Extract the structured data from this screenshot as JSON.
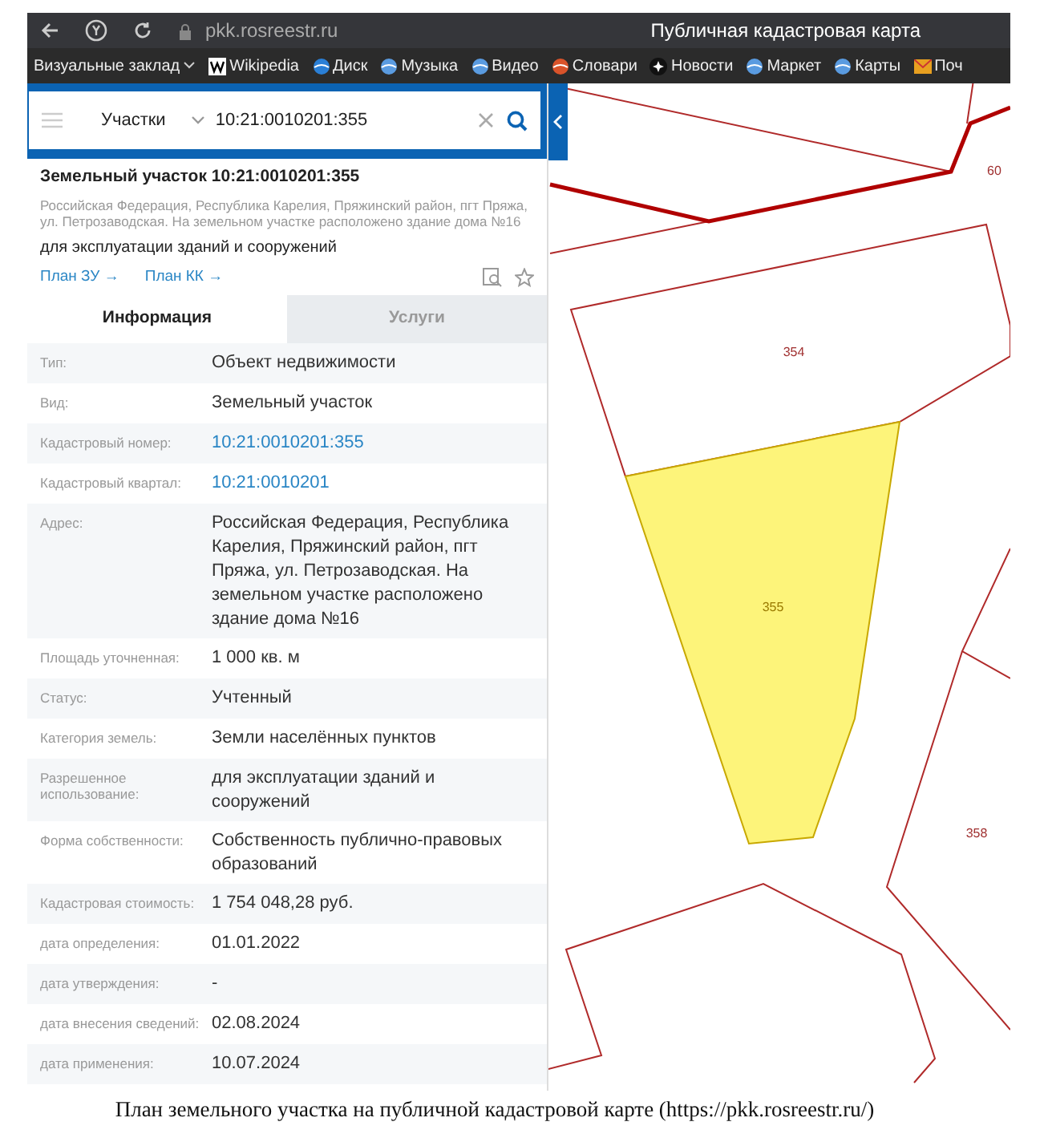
{
  "browser": {
    "url": "pkk.rosreestr.ru",
    "title": "Публичная кадастровая карта",
    "bookmarks": [
      {
        "label": "Визуальные заклад"
      },
      {
        "label": "Wikipedia"
      },
      {
        "label": "Диск"
      },
      {
        "label": "Музыка"
      },
      {
        "label": "Видео"
      },
      {
        "label": "Словари"
      },
      {
        "label": "Новости"
      },
      {
        "label": "Маркет"
      },
      {
        "label": "Карты"
      },
      {
        "label": "Поч"
      }
    ]
  },
  "search": {
    "category": "Участки",
    "value": "10:21:0010201:355"
  },
  "card": {
    "title": "Земельный участок 10:21:0010201:355",
    "address": "Российская Федерация, Республика Карелия, Пряжинский район, пгт Пряжа, ул. Петрозаводская. На земельном участке расположено здание дома №16",
    "purpose": "для эксплуатации зданий и сооружений",
    "links": [
      "План ЗУ →",
      "План КК →"
    ]
  },
  "tabs": [
    {
      "label": "Информация",
      "selected": true
    },
    {
      "label": "Услуги",
      "selected": false
    }
  ],
  "rows": [
    {
      "label": "Тип:",
      "value": "Объект недвижимости",
      "link": false
    },
    {
      "label": "Вид:",
      "value": "Земельный участок",
      "link": false
    },
    {
      "label": "Кадастровый номер:",
      "value": "10:21:0010201:355",
      "link": true
    },
    {
      "label": "Кадастровый квартал:",
      "value": "10:21:0010201",
      "link": true
    },
    {
      "label": "Адрес:",
      "value": "Российская Федерация, Республика Карелия, Пряжинский район, пгт Пряжа, ул. Петрозаводская. На земельном участке расположено здание дома №16",
      "link": false
    },
    {
      "label": "Площадь уточненная:",
      "value": "1 000 кв. м",
      "link": false
    },
    {
      "label": "Статус:",
      "value": "Учтенный",
      "link": false
    },
    {
      "label": "Категория земель:",
      "value": "Земли населённых пунктов",
      "link": false
    },
    {
      "label": "Разрешенное использование:",
      "value": "для эксплуатации зданий и сооружений",
      "link": false
    },
    {
      "label": "Форма собственности:",
      "value": "Собственность публично-правовых образований",
      "link": false
    },
    {
      "label": "Кадастровая стоимость:",
      "value": "1 754 048,28 руб.",
      "link": false
    },
    {
      "label": "дата определения:",
      "value": "01.01.2022",
      "link": false
    },
    {
      "label": "дата утверждения:",
      "value": "-",
      "link": false
    },
    {
      "label": "дата внесения сведений:",
      "value": "02.08.2024",
      "link": false
    },
    {
      "label": "дата применения:",
      "value": "10.07.2024",
      "link": false
    }
  ],
  "map": {
    "parcels": [
      {
        "label": "354",
        "selected": false
      },
      {
        "label": "355",
        "selected": true
      },
      {
        "label": "358",
        "selected": false
      },
      {
        "label": "60",
        "selected": false
      }
    ]
  },
  "caption": "План земельного участка на публичной кадастровой карте (https://pkk.rosreestr.ru/)"
}
